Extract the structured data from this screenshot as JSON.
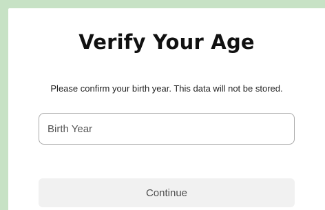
{
  "dialog": {
    "title": "Verify Your Age",
    "subtitle": "Please confirm your birth year. This data will not be stored.",
    "birth_year_input": {
      "value": "",
      "placeholder": "Birth Year"
    },
    "continue_label": "Continue"
  },
  "colors": {
    "page_background": "#c7e2c5",
    "card_background": "#ffffff",
    "title_text": "#111111",
    "input_border": "#a9a9a9",
    "button_background": "#f1f1f1",
    "button_text": "#4d4d4d"
  }
}
